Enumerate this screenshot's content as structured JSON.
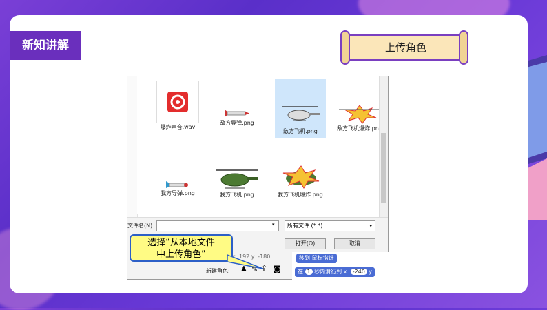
{
  "section_title": "新知讲解",
  "scroll_title": "上传角色",
  "files": [
    {
      "name": "爆炸声音.wav",
      "icon": "audio-file-icon"
    },
    {
      "name": "敌方导弹.png",
      "icon": "missile-icon"
    },
    {
      "name": "敌方飞机.png",
      "icon": "helicopter-icon"
    },
    {
      "name": "敌方飞机爆炸.png",
      "icon": "explosion-icon"
    },
    {
      "name": "我方导弹.png",
      "icon": "missile-icon"
    },
    {
      "name": "我方飞机.png",
      "icon": "helicopter-icon"
    },
    {
      "name": "我方飞机爆炸.png",
      "icon": "explosion-icon"
    }
  ],
  "dialog": {
    "filename_label": "文件名(N):",
    "filename_value": "",
    "filter_value": "所有文件 (*.*)",
    "open_label": "打开(O)",
    "cancel_label": "取消"
  },
  "callout": {
    "line1": "选择“从本地文件",
    "line2": "中上传角色”"
  },
  "sprite_bar": {
    "label": "新建角色:",
    "coords": "x: 192  y: -180"
  },
  "scratch_blocks": {
    "block1": "移到 鼠标指针",
    "block2_a": "在",
    "block2_n": "1",
    "block2_b": "秒内滑行到 x:",
    "block2_x": "-240",
    "block2_y": "y"
  },
  "colors": {
    "accent": "#6a2fbd",
    "callout_bg": "#fffb84",
    "callout_border": "#2c5fc7",
    "scroll_bg": "#fbe6b9"
  }
}
